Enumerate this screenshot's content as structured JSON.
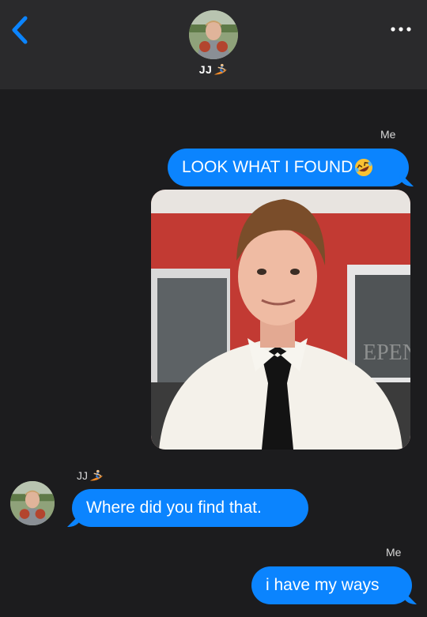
{
  "header": {
    "contact_name": "JJ",
    "contact_emoji": "surfer-emoji",
    "back_icon": "chevron-left-icon",
    "more_icon": "ellipsis-icon"
  },
  "messages": [
    {
      "sender": "Me",
      "text": "LOOK WHAT I FOUND",
      "emoji": "rolling-on-floor-laughing-emoji",
      "direction": "outgoing"
    },
    {
      "sender": "Me",
      "type": "photo",
      "description_icon": "selfie-photo",
      "direction": "outgoing"
    },
    {
      "sender": "JJ",
      "sender_emoji": "surfer-emoji",
      "text": "Where did you find that.",
      "direction": "incoming"
    },
    {
      "sender": "Me",
      "text": "i have my ways",
      "direction": "outgoing"
    }
  ],
  "colors": {
    "background": "#1c1c1e",
    "header": "#2a2a2c",
    "bubble": "#0b84fe",
    "accent": "#0b84fe"
  }
}
